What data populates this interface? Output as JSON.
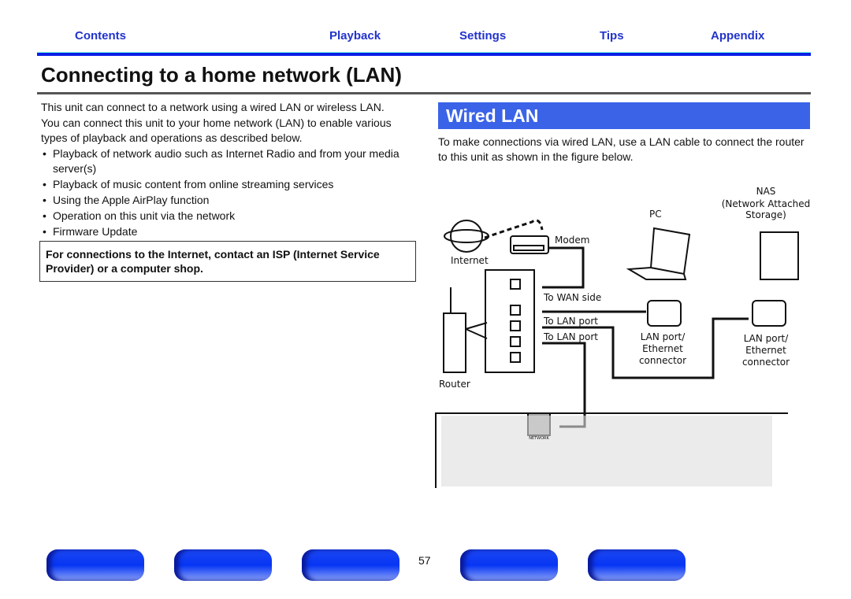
{
  "nav": {
    "tabs": [
      "Contents",
      "Playback",
      "Settings",
      "Tips",
      "Appendix"
    ]
  },
  "page": {
    "title": "Connecting to a home network (LAN)",
    "number": "57"
  },
  "intro": {
    "line1": "This unit can connect to a network using a wired LAN or wireless LAN.",
    "line2": "You can connect this unit to your home network (LAN) to enable various types of playback and operations as described below.",
    "bullets": [
      "Playback of network audio such as Internet Radio and from your media server(s)",
      "Playback of music content from online streaming services",
      "Using the Apple AirPlay function",
      "Operation on this unit via the network",
      "Firmware Update"
    ]
  },
  "note": "For connections to the Internet, contact an ISP (Internet Service Provider) or a computer shop.",
  "wired": {
    "heading": "Wired LAN",
    "text": "To make connections via wired LAN, use a LAN cable to connect the router to this unit as shown in the figure below."
  },
  "diagram": {
    "internet": "Internet",
    "modem": "Modem",
    "router": "Router",
    "wan": "To WAN side",
    "lan1": "To LAN port",
    "lan2": "To LAN port",
    "pc": "PC",
    "nas1": "NAS",
    "nas2": "(Network Attached",
    "nas3": "Storage)",
    "port1": "LAN port/",
    "port2": "Ethernet",
    "port3": "connector",
    "network": "NETWORK"
  },
  "colors": {
    "accent": "#3a63e8",
    "nav": "#2233cc",
    "bar": "#0a1ee6"
  }
}
